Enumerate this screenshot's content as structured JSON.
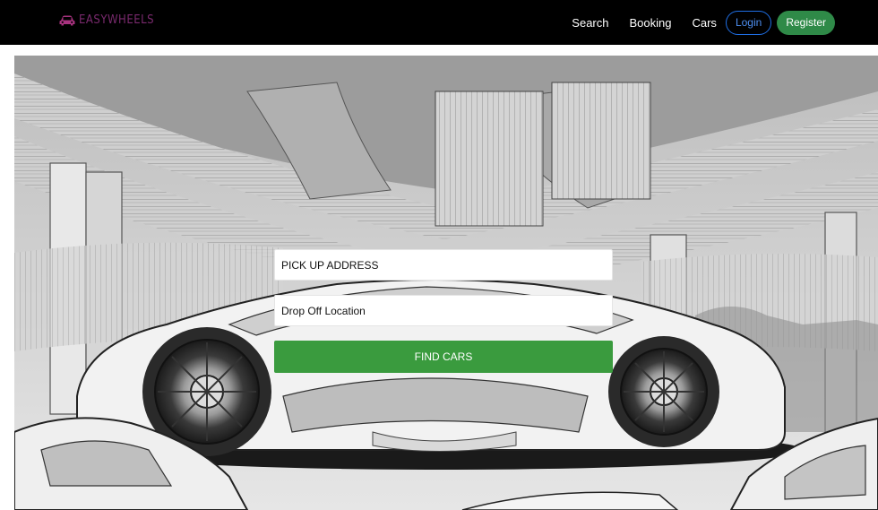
{
  "brand": {
    "name": "EASYWHEELS",
    "icon": "car-icon",
    "color": "#8a2f7c"
  },
  "nav": {
    "links": [
      "Search",
      "Booking",
      "Cars"
    ],
    "login_label": "Login",
    "register_label": "Register"
  },
  "colors": {
    "navbar": "#000000",
    "login_border": "#1f6fe5",
    "register_bg": "#2f8a48",
    "find_button": "#3a9b3e"
  },
  "search": {
    "pickup_value": "PICK UP ADDRESS",
    "dropoff_value": "Drop Off Location",
    "find_label": "FIND CARS"
  }
}
